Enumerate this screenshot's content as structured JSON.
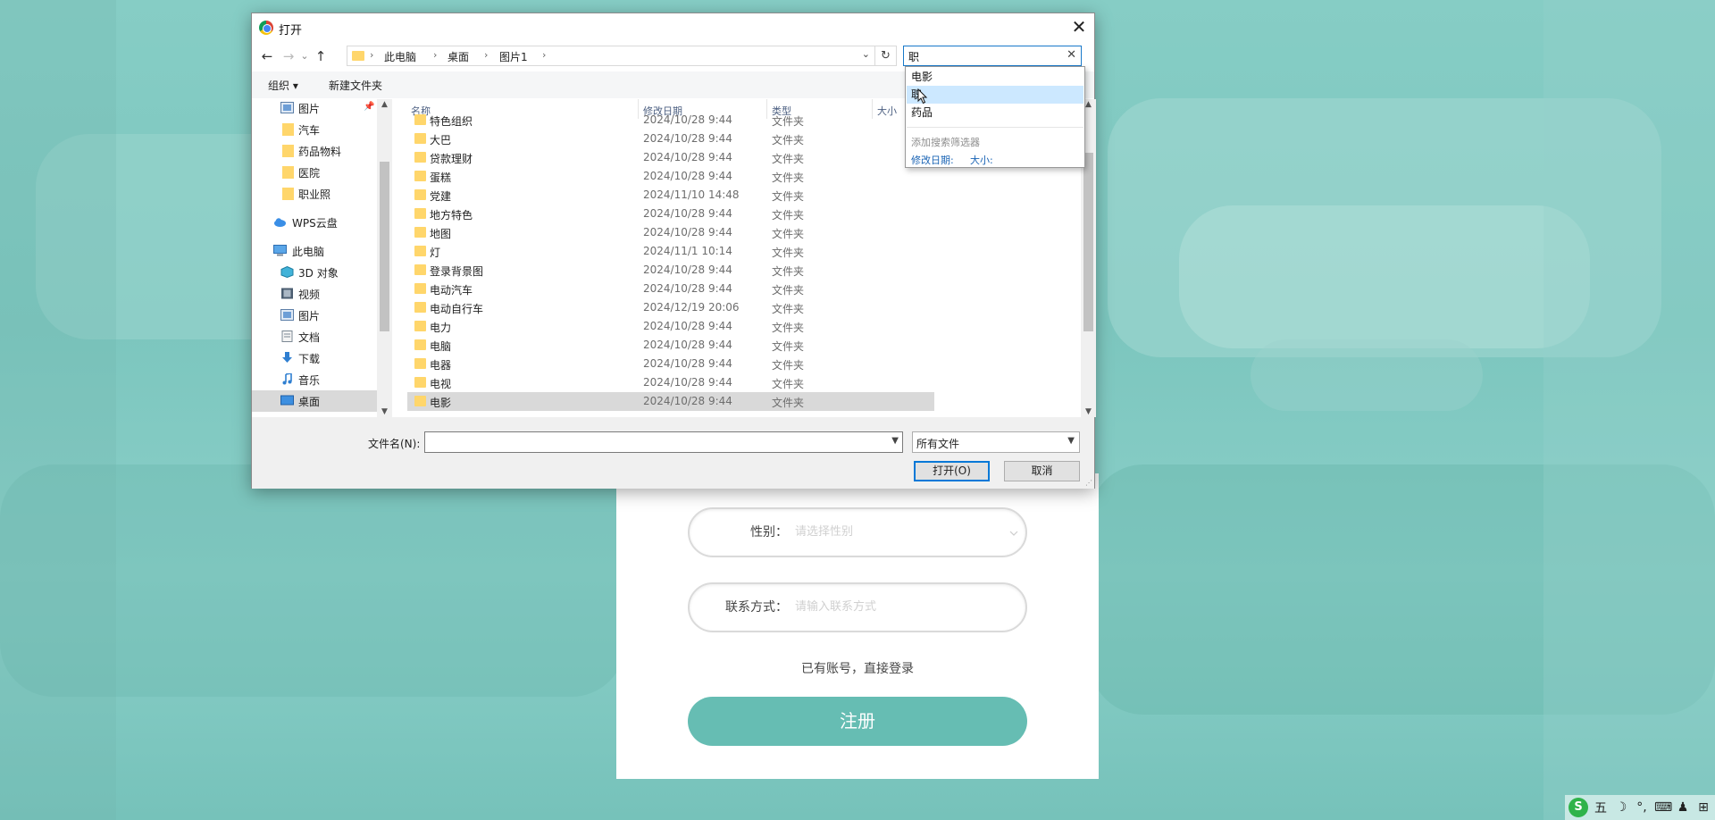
{
  "colors": {
    "background_teal": "#7ec7bf",
    "register_button": "#66bdb3",
    "selection_gray": "#d9d9d9",
    "dropdown_hover": "#cce8ff",
    "link_blue": "#1a64b5",
    "folder_yellow": "#ffd66b"
  },
  "dialog": {
    "title": "打开",
    "close_glyph": "✕",
    "nav": {
      "back": "←",
      "forward": "→",
      "recent": "⌄",
      "up": "↑",
      "refresh": "↻"
    },
    "address": {
      "crumbs": [
        "此电脑",
        "桌面",
        "图片1"
      ],
      "separator": "›",
      "dropdown": "⌄"
    },
    "search": {
      "value": "职",
      "clear": "✕"
    },
    "toolbar": {
      "organize": "组织 ▾",
      "new_folder": "新建文件夹"
    },
    "nav_pane": {
      "items": [
        {
          "label": "图片",
          "icon": "pictures-icon"
        },
        {
          "label": "汽车",
          "icon": "folder-icon"
        },
        {
          "label": "药品物料",
          "icon": "folder-icon"
        },
        {
          "label": "医院",
          "icon": "folder-icon"
        },
        {
          "label": "职业照",
          "icon": "folder-icon"
        },
        {
          "label": "WPS云盘",
          "icon": "cloud-icon"
        },
        {
          "label": "此电脑",
          "icon": "computer-icon"
        },
        {
          "label": "3D 对象",
          "icon": "3d-objects-icon"
        },
        {
          "label": "视频",
          "icon": "video-icon"
        },
        {
          "label": "图片",
          "icon": "pictures-icon"
        },
        {
          "label": "文档",
          "icon": "documents-icon"
        },
        {
          "label": "下载",
          "icon": "download-icon"
        },
        {
          "label": "音乐",
          "icon": "music-icon"
        },
        {
          "label": "桌面",
          "icon": "desktop-icon"
        }
      ],
      "pin_glyph": "📌"
    },
    "columns": {
      "name": "名称",
      "date": "修改日期",
      "type": "类型",
      "size": "大小"
    },
    "files": [
      {
        "name": "特色组织",
        "date": "2024/10/28 9:44",
        "type": "文件夹"
      },
      {
        "name": "大巴",
        "date": "2024/10/28 9:44",
        "type": "文件夹"
      },
      {
        "name": "贷款理财",
        "date": "2024/10/28 9:44",
        "type": "文件夹"
      },
      {
        "name": "蛋糕",
        "date": "2024/10/28 9:44",
        "type": "文件夹"
      },
      {
        "name": "党建",
        "date": "2024/11/10 14:48",
        "type": "文件夹"
      },
      {
        "name": "地方特色",
        "date": "2024/10/28 9:44",
        "type": "文件夹"
      },
      {
        "name": "地图",
        "date": "2024/10/28 9:44",
        "type": "文件夹"
      },
      {
        "name": "灯",
        "date": "2024/11/1 10:14",
        "type": "文件夹"
      },
      {
        "name": "登录背景图",
        "date": "2024/10/28 9:44",
        "type": "文件夹"
      },
      {
        "name": "电动汽车",
        "date": "2024/10/28 9:44",
        "type": "文件夹"
      },
      {
        "name": "电动自行车",
        "date": "2024/12/19 20:06",
        "type": "文件夹"
      },
      {
        "name": "电力",
        "date": "2024/10/28 9:44",
        "type": "文件夹"
      },
      {
        "name": "电脑",
        "date": "2024/10/28 9:44",
        "type": "文件夹"
      },
      {
        "name": "电器",
        "date": "2024/10/28 9:44",
        "type": "文件夹"
      },
      {
        "name": "电视",
        "date": "2024/10/28 9:44",
        "type": "文件夹"
      },
      {
        "name": "电影",
        "date": "2024/10/28 9:44",
        "type": "文件夹"
      }
    ],
    "search_suggestions": {
      "items": [
        "电影",
        "职",
        "药品"
      ],
      "add_filter_hint": "添加搜索筛选器",
      "filters": [
        "修改日期:",
        "大小:"
      ]
    },
    "bottom": {
      "filename_label": "文件名(N):",
      "filename_value": "",
      "filetype_value": "所有文件",
      "open_button": "打开(O)",
      "cancel_button": "取消"
    }
  },
  "register_form": {
    "gender": {
      "label": "性别：",
      "placeholder": "请选择性别"
    },
    "contact": {
      "label": "联系方式：",
      "placeholder": "请输入联系方式"
    },
    "login_link": "已有账号，直接登录",
    "submit": "注册"
  },
  "tray": {
    "ime_logo": "S",
    "ime_mode": "五",
    "moon": "☽",
    "punct": "°,",
    "keyboard": "⌨",
    "user": "♟",
    "grid": "⊞"
  }
}
